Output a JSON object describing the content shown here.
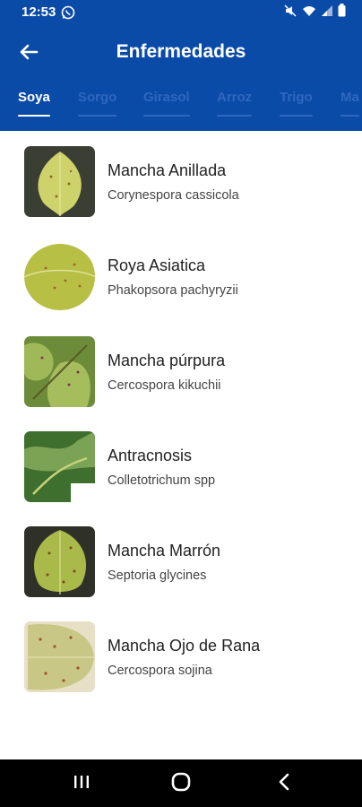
{
  "status_bar": {
    "time": "12:53",
    "icons": [
      "whatsapp-icon",
      "mute-icon",
      "wifi-icon",
      "signal-icon",
      "battery-icon"
    ]
  },
  "app_bar": {
    "title": "Enfermedades",
    "back_icon": "arrow-left-icon",
    "color": "#0b4ba8"
  },
  "tabs": [
    {
      "label": "Soya",
      "active": true
    },
    {
      "label": "Sorgo",
      "active": false
    },
    {
      "label": "Girasol",
      "active": false
    },
    {
      "label": "Arroz",
      "active": false
    },
    {
      "label": "Trigo",
      "active": false
    },
    {
      "label": "Ma",
      "active": false
    }
  ],
  "diseases": [
    {
      "name": "Mancha Anillada",
      "scientific": "Corynespora cassicola"
    },
    {
      "name": "Roya Asiatica",
      "scientific": "Phakopsora pachyryzii"
    },
    {
      "name": "Mancha púrpura",
      "scientific": "Cercospora kikuchii"
    },
    {
      "name": "Antracnosis",
      "scientific": "Colletotrichum spp"
    },
    {
      "name": "Mancha Marrón",
      "scientific": "Septoria glycines"
    },
    {
      "name": "Mancha Ojo de Rana",
      "scientific": "Cercospora sojina"
    }
  ],
  "nav_bar": {
    "icons": [
      "recent-apps-icon",
      "home-icon",
      "back-nav-icon"
    ]
  }
}
